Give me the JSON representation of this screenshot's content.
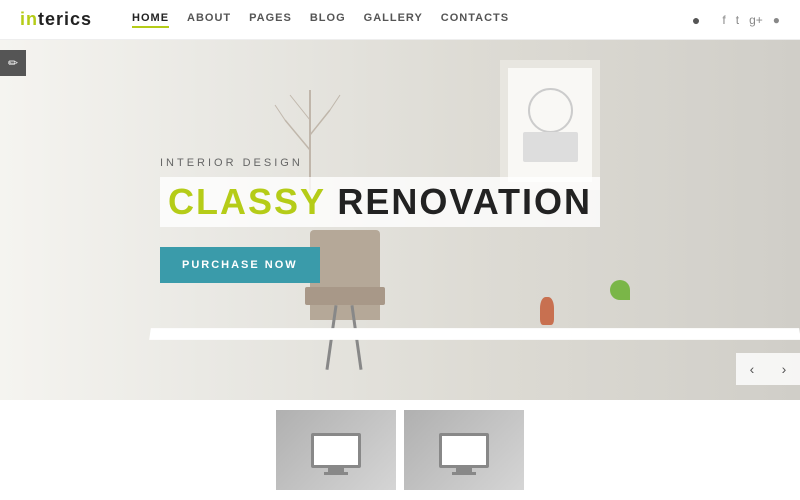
{
  "header": {
    "logo": {
      "part1": "in",
      "part2": "ter",
      "part3": "ics"
    },
    "nav": {
      "items": [
        {
          "label": "HOME",
          "active": true
        },
        {
          "label": "ABOUT",
          "active": false
        },
        {
          "label": "PAGES",
          "active": false
        },
        {
          "label": "BLOG",
          "active": false
        },
        {
          "label": "GALLERY",
          "active": false
        },
        {
          "label": "CONTACTS",
          "active": false
        }
      ]
    },
    "social": [
      "f",
      "t",
      "g+",
      "ig"
    ],
    "user_icon": "👤"
  },
  "hero": {
    "subtitle": "INTERIOR DESIGN",
    "title_classy": "CLASSY",
    "title_rest": " RENOVATION",
    "cta_label": "PURCHASE NOW"
  },
  "thumbnails": [
    {
      "id": 1
    },
    {
      "id": 2
    }
  ],
  "edit_icon": "✏"
}
